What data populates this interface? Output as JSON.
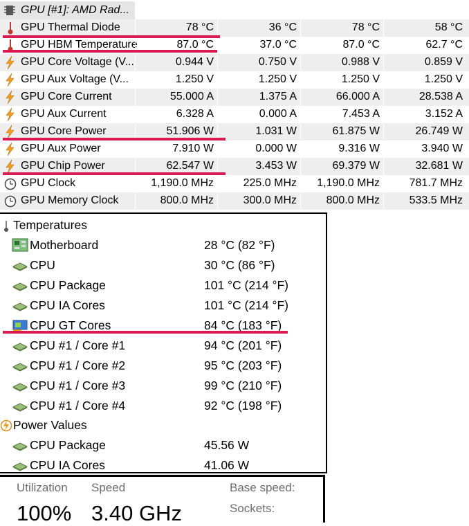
{
  "gpu": {
    "title": "GPU [#1]: AMD Rad...",
    "rows": [
      {
        "label": "GPU Thermal Diode",
        "icon": "thermometer-icon",
        "values": [
          "78 °C",
          "36 °C",
          "78 °C",
          "58 °C"
        ]
      },
      {
        "label": "GPU HBM Temperature",
        "icon": "thermometer-icon",
        "values": [
          "87.0 °C",
          "37.0 °C",
          "87.0 °C",
          "62.7 °C"
        ]
      },
      {
        "label": "GPU Core Voltage (V...",
        "icon": "lightning-icon",
        "values": [
          "0.944 V",
          "0.750 V",
          "0.988 V",
          "0.859 V"
        ]
      },
      {
        "label": "GPU Aux Voltage (V...",
        "icon": "lightning-icon",
        "values": [
          "1.250 V",
          "1.250 V",
          "1.250 V",
          "1.250 V"
        ]
      },
      {
        "label": "GPU Core Current",
        "icon": "lightning-icon",
        "values": [
          "55.000 A",
          "1.375 A",
          "66.000 A",
          "28.538 A"
        ]
      },
      {
        "label": "GPU Aux Current",
        "icon": "lightning-icon",
        "values": [
          "6.328 A",
          "0.000 A",
          "7.453 A",
          "3.152 A"
        ]
      },
      {
        "label": "GPU Core Power",
        "icon": "lightning-icon",
        "values": [
          "51.906 W",
          "1.031 W",
          "61.875 W",
          "26.749 W"
        ]
      },
      {
        "label": "GPU Aux Power",
        "icon": "lightning-icon",
        "values": [
          "7.910 W",
          "0.000 W",
          "9.316 W",
          "3.940 W"
        ]
      },
      {
        "label": "GPU Chip Power",
        "icon": "lightning-icon",
        "values": [
          "62.547 W",
          "3.453 W",
          "69.379 W",
          "32.681 W"
        ]
      },
      {
        "label": "GPU Clock",
        "icon": "clock-icon",
        "values": [
          "1,190.0 MHz",
          "225.0 MHz",
          "1,190.0 MHz",
          "781.7 MHz"
        ]
      },
      {
        "label": "GPU Memory Clock",
        "icon": "clock-icon",
        "values": [
          "800.0 MHz",
          "300.0 MHz",
          "800.0 MHz",
          "533.5 MHz"
        ]
      }
    ]
  },
  "sensors": {
    "temperatures_label": "Temperatures",
    "temperatures": [
      {
        "label": "Motherboard",
        "value": "28 °C  (82 °F)",
        "icon": "motherboard-icon"
      },
      {
        "label": "CPU",
        "value": "30 °C  (86 °F)",
        "icon": "cpu-chip-icon"
      },
      {
        "label": "CPU Package",
        "value": "101 °C  (214 °F)",
        "icon": "cpu-chip-icon"
      },
      {
        "label": "CPU IA Cores",
        "value": "101 °C  (214 °F)",
        "icon": "cpu-chip-icon"
      },
      {
        "label": "CPU GT Cores",
        "value": "84 °C  (183 °F)",
        "icon": "gpu-card-icon"
      },
      {
        "label": "CPU #1 / Core #1",
        "value": "94 °C  (201 °F)",
        "icon": "cpu-chip-icon"
      },
      {
        "label": "CPU #1 / Core #2",
        "value": "95 °C  (203 °F)",
        "icon": "cpu-chip-icon"
      },
      {
        "label": "CPU #1 / Core #3",
        "value": "99 °C  (210 °F)",
        "icon": "cpu-chip-icon"
      },
      {
        "label": "CPU #1 / Core #4",
        "value": "92 °C  (198 °F)",
        "icon": "cpu-chip-icon"
      }
    ],
    "power_label": "Power Values",
    "power": [
      {
        "label": "CPU Package",
        "value": "45.56 W",
        "icon": "cpu-chip-icon"
      },
      {
        "label": "CPU IA Cores",
        "value": "41.06 W",
        "icon": "cpu-chip-icon"
      }
    ]
  },
  "performance": {
    "utilization_label": "Utilization",
    "utilization_value": "100%",
    "speed_label": "Speed",
    "speed_value": "3.40 GHz",
    "base_speed_label": "Base speed:",
    "sockets_label": "Sockets:"
  },
  "colors": {
    "highlight": "#d81b50",
    "row_alt": "#eeeeee",
    "label_gray": "#6e6e6e"
  }
}
